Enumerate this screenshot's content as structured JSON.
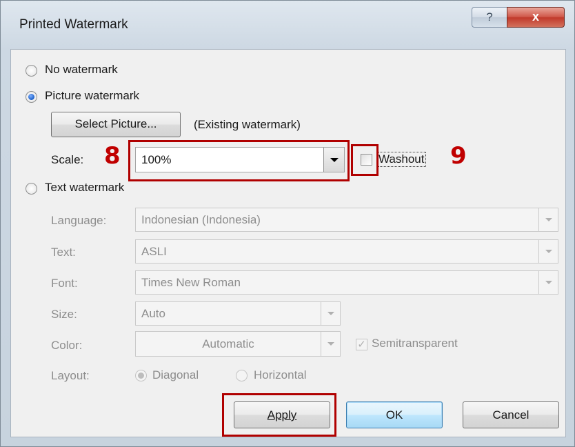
{
  "dialog": {
    "title": "Printed Watermark",
    "help_glyph": "?",
    "close_glyph": "x"
  },
  "options": {
    "no_watermark": "No watermark",
    "picture_watermark": "Picture watermark",
    "text_watermark": "Text watermark",
    "selected": "picture_watermark"
  },
  "picture": {
    "select_button": "Select Picture...",
    "existing_label": "(Existing watermark)",
    "scale_label": "Scale:",
    "scale_value": "100%",
    "washout_label": "Washout",
    "washout_checked": false
  },
  "text_section": {
    "language_label": "Language:",
    "language_value": "Indonesian (Indonesia)",
    "text_label": "Text:",
    "text_value": "ASLI",
    "font_label": "Font:",
    "font_value": "Times New Roman",
    "size_label": "Size:",
    "size_value": "Auto",
    "color_label": "Color:",
    "color_value": "Automatic",
    "semitransparent_label": "Semitransparent",
    "semitransparent_checked": true,
    "layout_label": "Layout:",
    "layout_diagonal": "Diagonal",
    "layout_horizontal": "Horizontal",
    "layout_selected": "diagonal"
  },
  "buttons": {
    "apply": "Apply",
    "ok": "OK",
    "cancel": "Cancel"
  },
  "annotations": {
    "marker_8": "8",
    "marker_9": "9",
    "highlight_color": "#b00000"
  }
}
